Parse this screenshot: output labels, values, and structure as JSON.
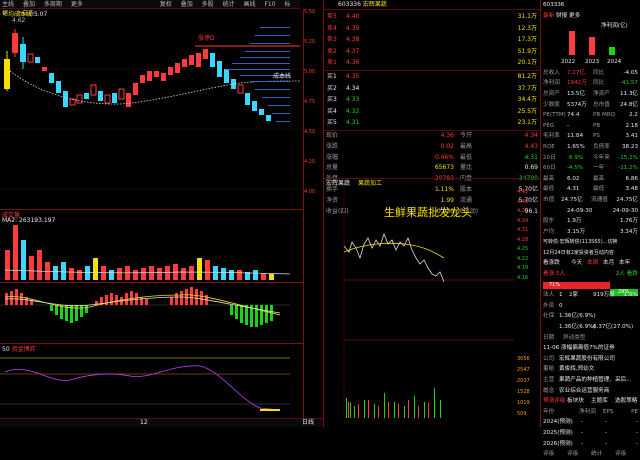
{
  "toolbar": {
    "left_items": [
      "主线",
      "叠加",
      "多周期",
      "更多"
    ],
    "mid_items": [
      "复权",
      "叠加",
      "多股",
      "统计",
      "画线",
      "F10",
      "标记",
      "+自选",
      "返回"
    ]
  },
  "chart": {
    "title": "平均成本线",
    "price_label": "5.07",
    "small_label": "4.62",
    "ma_label": "成本线",
    "tag_label": "涨停D",
    "axis": [
      "5.50",
      "5.25",
      "5.00",
      "4.75",
      "4.50",
      "4.25",
      "4.00"
    ]
  },
  "vol": {
    "title": "成交量",
    "ma_text": "MA2: 263193.197",
    "axis": [
      "10000",
      "5000",
      "X100"
    ]
  },
  "macd": {
    "title": "MACD"
  },
  "ind3": {
    "title": "资金博弈"
  },
  "bottom": {
    "day_label": "日线",
    "num": "12",
    "pct": "5.0%"
  },
  "stock": {
    "code": "603336",
    "name": "宏辉果蔬",
    "header_tabs": [
      "筹码",
      "逐笔"
    ]
  },
  "orderbook": {
    "asks": [
      {
        "label": "卖5",
        "price": "4.40",
        "vol": "31.1万"
      },
      {
        "label": "卖4",
        "price": "4.39",
        "vol": "12.3万"
      },
      {
        "label": "卖3",
        "price": "4.38",
        "vol": "17.3万"
      },
      {
        "label": "卖2",
        "price": "4.37",
        "vol": "51.9万"
      },
      {
        "label": "卖1",
        "price": "4.36",
        "vol": "20.1万"
      }
    ],
    "bids": [
      {
        "label": "买1",
        "price": "4.35",
        "vol": "81.2万"
      },
      {
        "label": "买2",
        "price": "4.34",
        "vol": "37.7万"
      },
      {
        "label": "买3",
        "price": "4.33",
        "vol": "34.4万"
      },
      {
        "label": "买4",
        "price": "4.32",
        "vol": "25.5万"
      },
      {
        "label": "买5",
        "price": "4.31",
        "vol": "23.1万"
      }
    ]
  },
  "quote": [
    {
      "a": "现价",
      "b": "4.36",
      "c": "今开",
      "d": "4.34"
    },
    {
      "a": "涨跌",
      "b": "0.02",
      "c": "最高",
      "d": "4.43"
    },
    {
      "a": "涨幅",
      "b": "0.46%",
      "c": "最低",
      "d": "4.31"
    },
    {
      "a": "总量",
      "b": "65673",
      "c": "量比",
      "d": "0.69"
    },
    {
      "a": "外盘",
      "b": "20783",
      "c": "内盘",
      "d": "34790"
    },
    {
      "a": "换手",
      "b": "1.11%",
      "c": "股本",
      "d": "5.70亿"
    },
    {
      "a": "净资",
      "b": "1.99",
      "c": "流通",
      "d": "5.70亿"
    },
    {
      "a": "收益(四)",
      "b": "0.030",
      "c": "PE(动)",
      "d": "96.1"
    }
  ],
  "mini": {
    "tabs": [
      "宏辉果蔬",
      "果蔬加工"
    ],
    "headline": "生鲜果蔬批发龙头",
    "axis": [
      "4.43",
      "4.40",
      "4.37",
      "4.34",
      "4.31",
      "4.28",
      "4.25",
      "4.22",
      "4.19",
      "4.16"
    ],
    "vol_axis": [
      "3056",
      "2547",
      "2037",
      "1528",
      "1019",
      "509"
    ]
  },
  "right": {
    "code": "603336",
    "tabs": [
      "最新",
      "财报",
      "更多"
    ],
    "profit_label": "净利润(亿)",
    "chart_years": [
      "2022",
      "2023",
      "2024"
    ],
    "rows": [
      [
        "总收入",
        "7.27亿",
        "同比",
        "-4.05"
      ],
      [
        "净利润",
        "1942万",
        "同比",
        "-41.57"
      ],
      [
        "总资产",
        "13.5亿",
        "净资产",
        "11.3亿"
      ],
      [
        "少数股",
        "5374万",
        "总市值",
        "24.8亿"
      ],
      [
        "PE(TTM)",
        "74.4",
        "PB MRQ",
        "2.2"
      ],
      [
        "PEG",
        "-",
        "PB",
        "2.18"
      ],
      [
        "毛利率",
        "11.84",
        "PS",
        "3.41"
      ],
      [
        "ROE",
        "1.65%",
        "负债率",
        "38.23"
      ],
      [
        "20日",
        "-6.9%",
        "今年来",
        "-15.1%"
      ],
      [
        "60日",
        "-4.5%",
        "一年",
        "-21.2%"
      ],
      [
        "最高",
        "6.02",
        "最高",
        "6.86"
      ],
      [
        "最低",
        "4.31",
        "最低",
        "3.48"
      ],
      [
        "市值",
        "24.75亿",
        "流通值",
        "24.75亿"
      ]
    ],
    "dates": [
      "24-09-30",
      "24-09-30"
    ],
    "rows2": [
      [
        "股东",
        "1.9万",
        "",
        "1.76万"
      ],
      [
        "户均",
        "3.15万",
        "",
        "3.34万"
      ],
      [
        "",
        "3.15万",
        "",
        ""
      ]
    ],
    "news1": "可转债:宏辉转债(113565)...切换",
    "news2": "12月24日有2家投资者互动内容",
    "vote_title": "看涨跌",
    "vote_tabs": [
      "今天",
      "本周",
      "本月",
      "本年"
    ],
    "vote_left": "看涨 5人",
    "vote_right": "2人 看跌",
    "bar_left": "71%",
    "bar_right": "29%",
    "more1": [
      [
        "法人",
        "1",
        "2家",
        "919万股",
        "1.6%"
      ],
      [
        "外资",
        "0",
        "",
        "",
        ""
      ],
      [
        "社保",
        "1.36亿(6.9%)",
        "",
        "",
        ""
      ],
      [
        "",
        "1.36亿(6.9%)",
        "",
        "6.37亿(27.0%)",
        ""
      ]
    ],
    "sec1_title": "日期",
    "sec1_tab": "异动类型",
    "event": "11-06 涨幅偏离值7%的证券",
    "info": [
      [
        "公司",
        "宏辉果蔬股份有限公司"
      ],
      [
        "董秘",
        "黄俊辉,郑幼文"
      ],
      [
        "主营",
        "果蔬产品的种植管理、采后..."
      ],
      [
        "概念",
        "农业综合运营服务商"
      ]
    ],
    "rating_tabs": [
      "预测评级",
      "板块块",
      "主题库",
      "选股策略"
    ],
    "forecast_head": [
      "年份",
      "净利润",
      "EPS",
      "PE"
    ],
    "forecast": [
      [
        "2024(预测)",
        "-",
        "-",
        "-"
      ],
      [
        "2025(预测)",
        "-",
        "-",
        "-"
      ],
      [
        "2026(预测)",
        "-",
        "-",
        "-"
      ]
    ],
    "footer": [
      "评级",
      "评级",
      "统计",
      "评级"
    ]
  },
  "colors": {
    "up": "#ff3b3b",
    "down": "#19d419",
    "bg": "#000000",
    "grid": "#7a1010",
    "yellow": "#f5e000",
    "cyan": "#39d8ff"
  }
}
